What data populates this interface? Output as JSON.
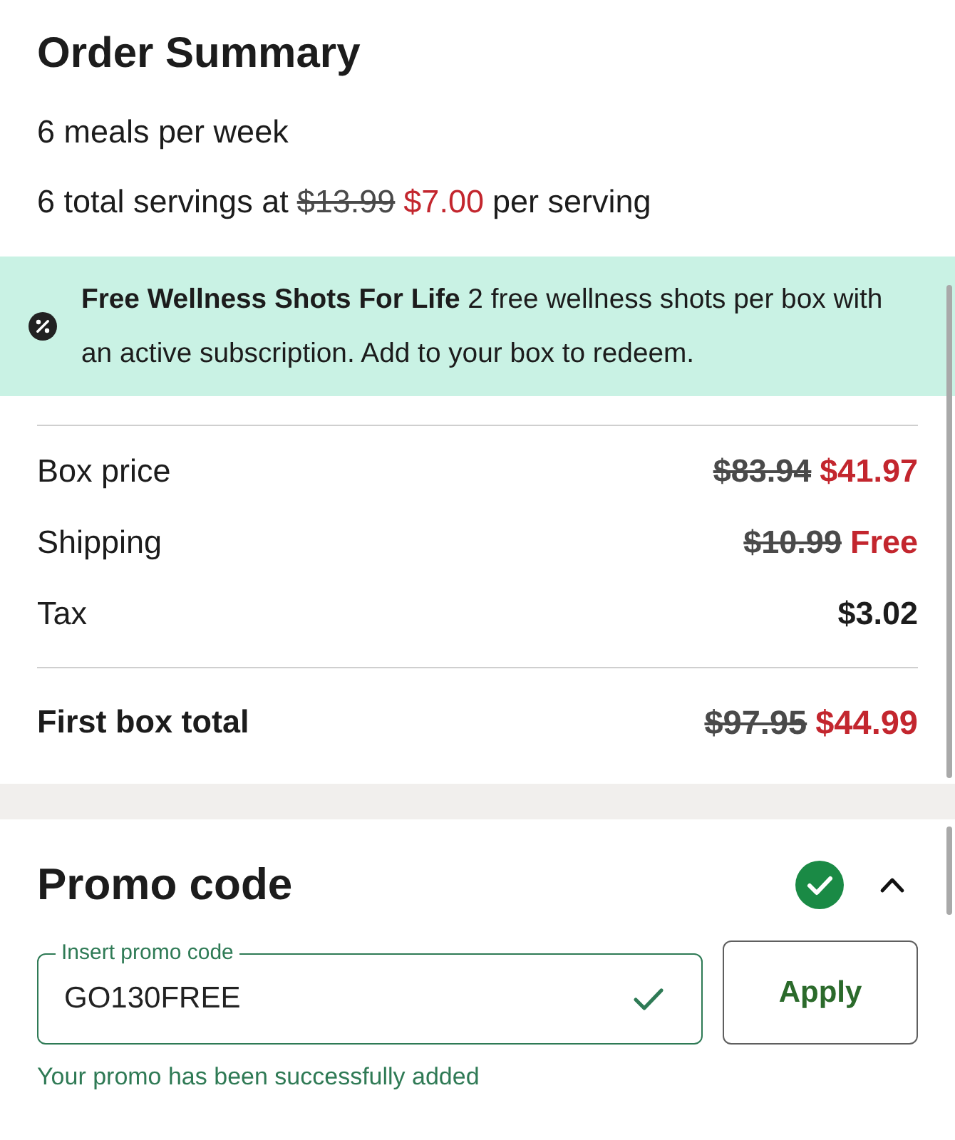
{
  "title": "Order Summary",
  "plan": {
    "meals": "6 meals per week",
    "servings_prefix": "6 total servings at",
    "original_price": "$13.99",
    "price": "$7.00",
    "servings_suffix": "per serving"
  },
  "banner": {
    "text": "**Free Wellness Shots For Life** 2 free wellness shots per box with an active subscription. Add to your box to redeem."
  },
  "lines": [
    {
      "label": "Box price",
      "original": "$83.94",
      "price": "$41.97",
      "discounted": true
    },
    {
      "label": "Shipping",
      "original": "$10.99",
      "price": "Free",
      "discounted": true
    },
    {
      "label": "Tax",
      "price": "$3.02",
      "discounted": false
    }
  ],
  "total": {
    "label": "First box total",
    "original": "$97.95",
    "price": "$44.99",
    "discounted": true
  },
  "promo": {
    "title": "Promo code",
    "applied": true,
    "expanded": true,
    "field": {
      "label": "Insert promo code",
      "value": "GO130FREE",
      "valid": true
    },
    "button": "Apply",
    "message": "Your promo has been successfully added"
  }
}
